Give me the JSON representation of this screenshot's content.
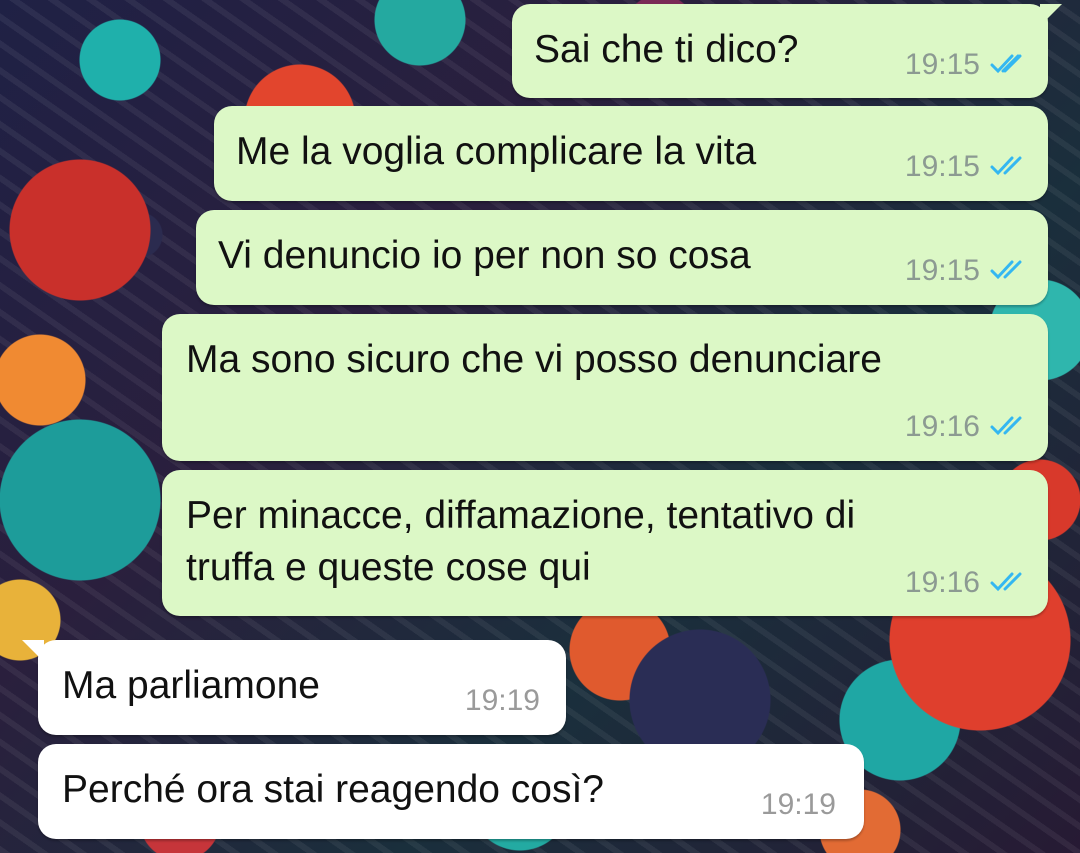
{
  "messages": [
    {
      "direction": "outgoing",
      "text": "Sai che ti dico?",
      "time": "19:15",
      "status_icon": "double-check-read-icon"
    },
    {
      "direction": "outgoing",
      "text": "Me la voglia complicare la vita",
      "time": "19:15",
      "status_icon": "double-check-read-icon"
    },
    {
      "direction": "outgoing",
      "text": "Vi denuncio io per non so cosa",
      "time": "19:15",
      "status_icon": "double-check-read-icon"
    },
    {
      "direction": "outgoing",
      "text": "Ma sono sicuro che vi posso denunciare",
      "time": "19:16",
      "status_icon": "double-check-read-icon"
    },
    {
      "direction": "outgoing",
      "lines": [
        "Per minacce, diffamazione, tentativo di",
        "truffa e queste cose qui"
      ],
      "time": "19:16",
      "status_icon": "double-check-read-icon"
    },
    {
      "direction": "incoming",
      "text": "Ma parliamone",
      "time": "19:19"
    },
    {
      "direction": "incoming",
      "text": "Perché ora stai reagendo così?",
      "time": "19:19"
    }
  ],
  "colors": {
    "outgoing_bubble": "#dcf8c6",
    "incoming_bubble": "#ffffff",
    "read_ticks": "#34b7f1",
    "timestamp": "#8c9a92"
  }
}
